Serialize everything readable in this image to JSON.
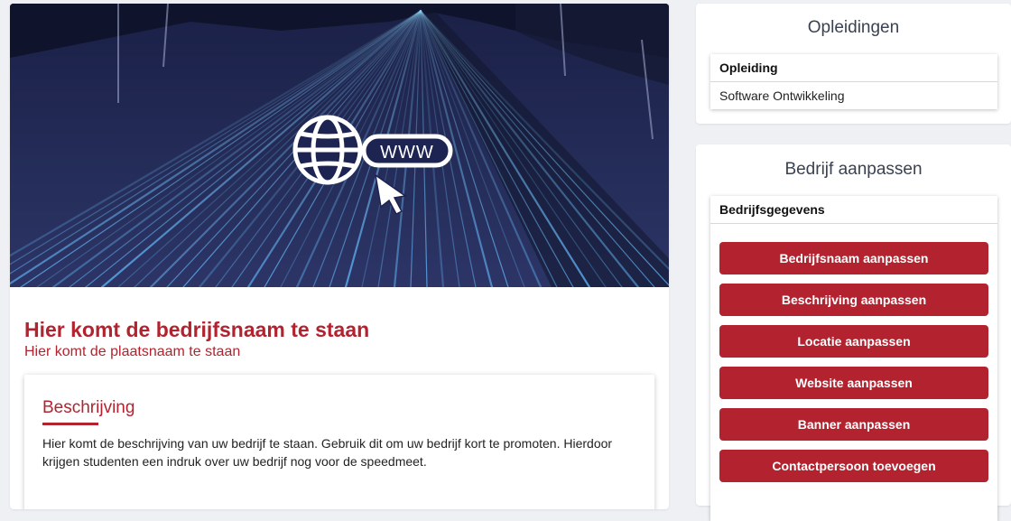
{
  "banner": {
    "url_text": "WWW",
    "colors": {
      "sky": "#141a33",
      "light": "#6ec6ff",
      "accent": "#3b4aa8"
    }
  },
  "company": {
    "name": "Hier komt de bedrijfsnaam te staan",
    "city": "Hier komt de plaatsnaam te staan"
  },
  "description": {
    "title": "Beschrijving",
    "text": "Hier komt de beschrijving van uw bedrijf te staan. Gebruik dit om uw bedrijf kort te promoten. Hierdoor krijgen studenten een indruk over uw bedrijf nog voor de speedmeet."
  },
  "opleidingen": {
    "title": "Opleidingen",
    "table_header": "Opleiding",
    "rows": [
      "Software Ontwikkeling"
    ]
  },
  "bedrijf": {
    "title": "Bedrijf aanpassen",
    "table_header": "Bedrijfsgegevens",
    "buttons": [
      "Bedrijfsnaam aanpassen",
      "Beschrijving aanpassen",
      "Locatie aanpassen",
      "Website aanpassen",
      "Banner aanpassen",
      "Contactpersoon toevoegen"
    ]
  },
  "theme": {
    "accent": "#b3232f",
    "background": "#eef0f4"
  }
}
